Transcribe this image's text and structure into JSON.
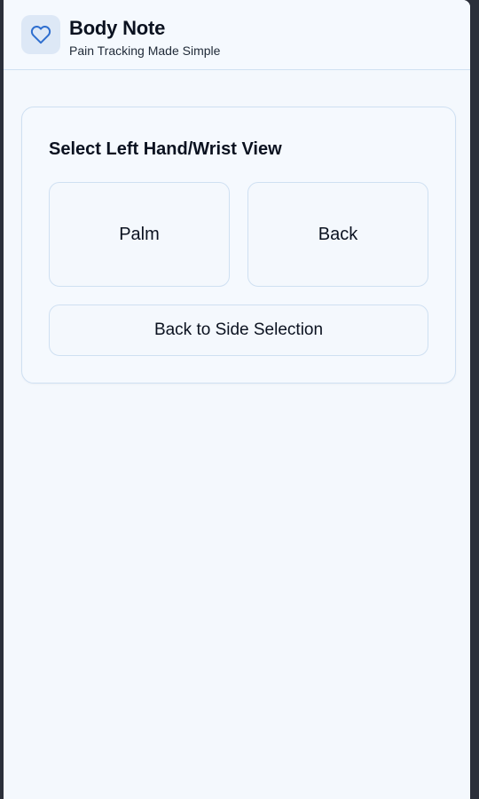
{
  "app": {
    "title": "Body Note",
    "subtitle": "Pain Tracking Made Simple",
    "logo_icon": "heart-icon"
  },
  "view_selection": {
    "title": "Select Left Hand/Wrist View",
    "options": [
      {
        "label": "Palm"
      },
      {
        "label": "Back"
      }
    ],
    "back_label": "Back to Side Selection"
  },
  "colors": {
    "accent": "#2f6fcf",
    "background": "#f4f8fd",
    "border": "#cfe0f2",
    "logo_bg": "#dde8f6"
  }
}
